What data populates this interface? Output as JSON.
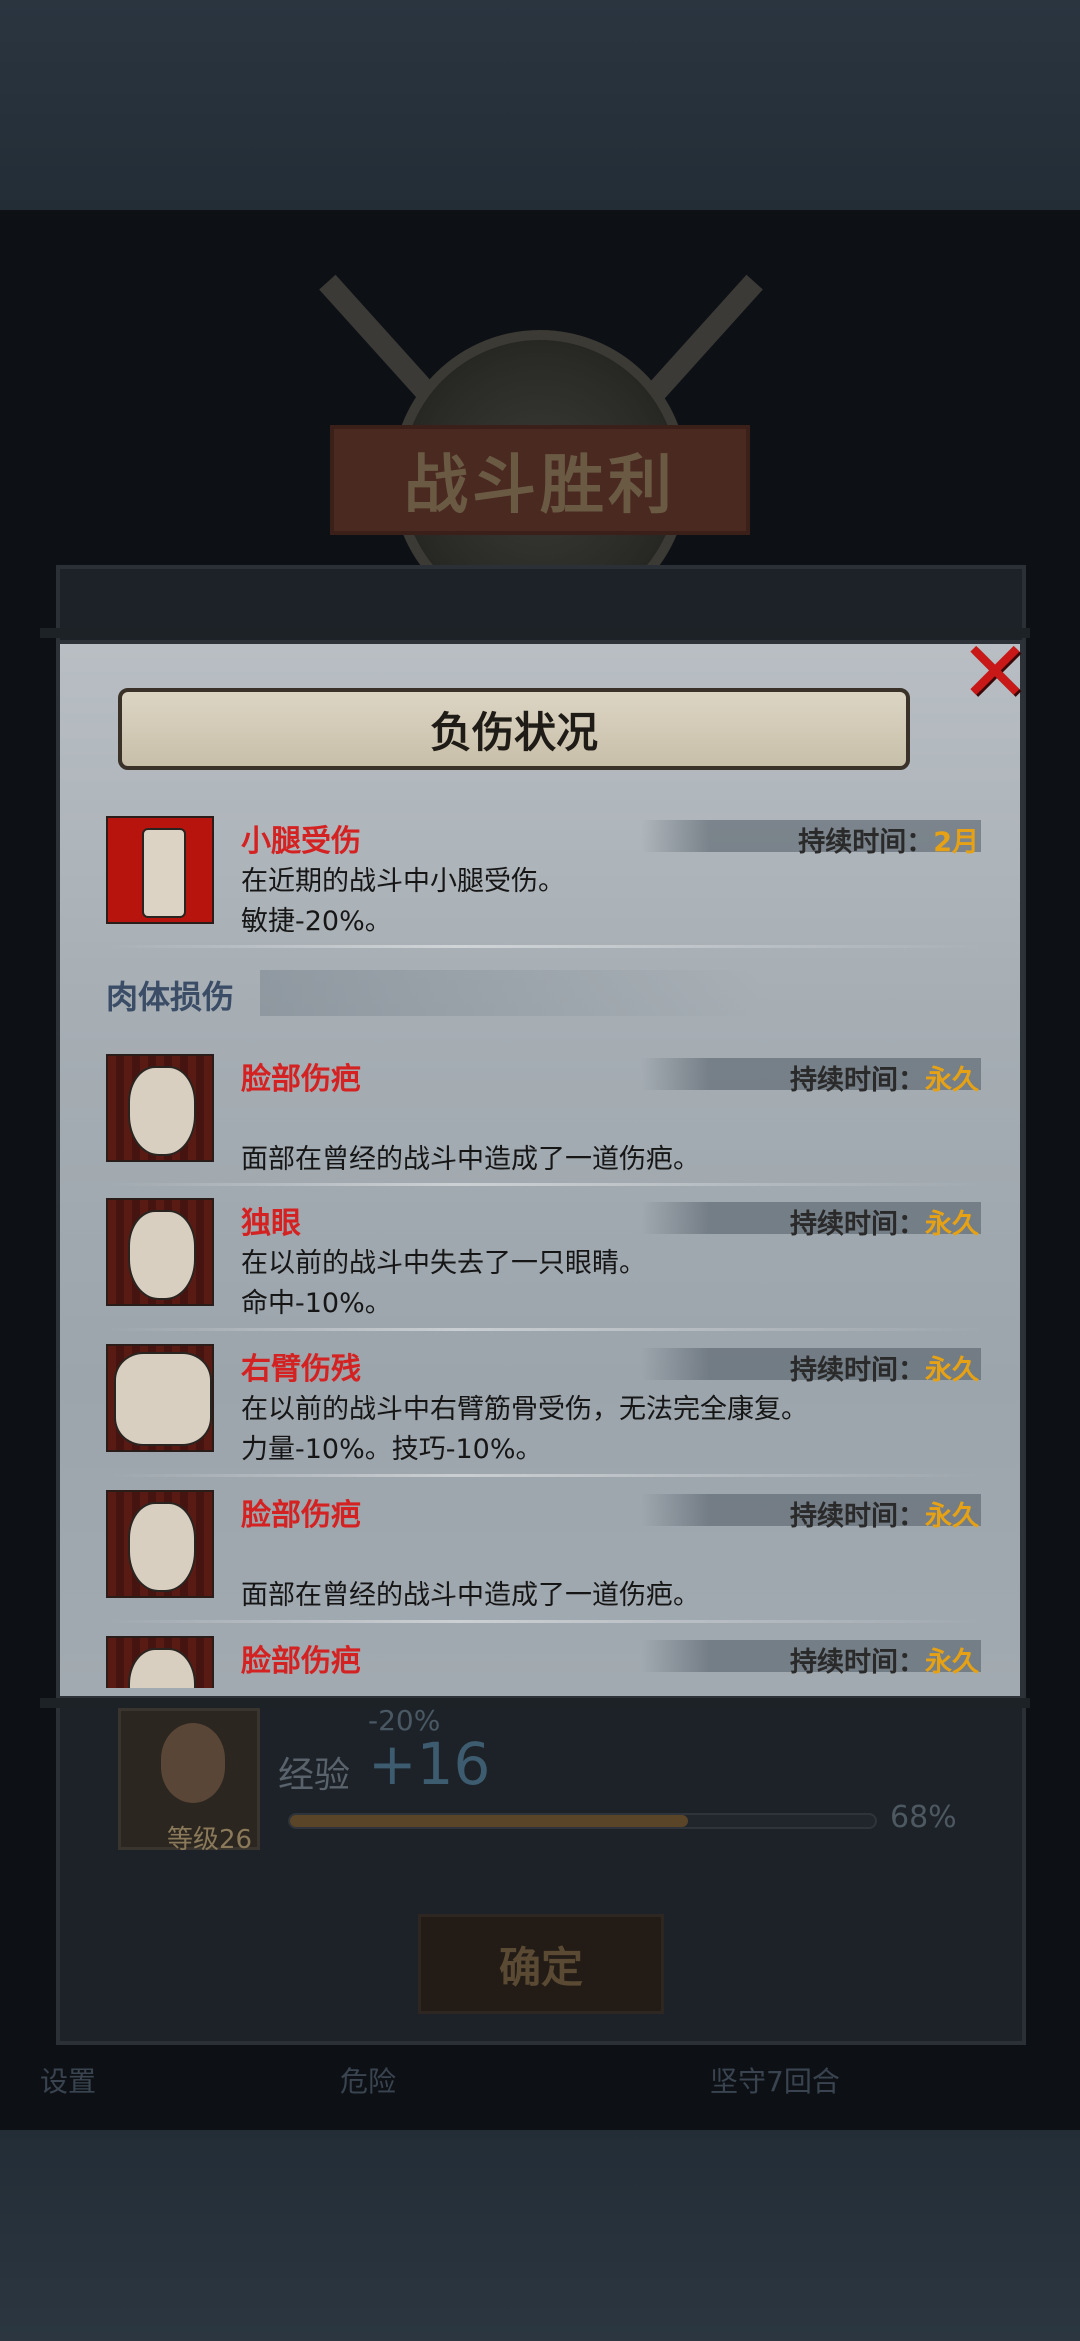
{
  "victory_title": "战斗胜利",
  "dialog": {
    "title": "负伤状况",
    "close_symbol": "✕",
    "section_label": "肉体损伤",
    "duration_label": "持续时间：",
    "injuries": [
      {
        "name": "小腿受伤",
        "duration": "2月",
        "icon": "bandaged-leg-icon",
        "lines": [
          "在近期的战斗中小腿受伤。",
          "敏捷-20%。"
        ]
      },
      {
        "name": "脸部伤疤",
        "duration": "永久",
        "icon": "bandaged-face-icon",
        "lines": [
          "",
          "面部在曾经的战斗中造成了一道伤疤。"
        ]
      },
      {
        "name": "独眼",
        "duration": "永久",
        "icon": "bandaged-face-icon",
        "lines": [
          "在以前的战斗中失去了一只眼睛。",
          "命中-10%。"
        ]
      },
      {
        "name": "右臂伤残",
        "duration": "永久",
        "icon": "bandaged-arm-icon",
        "lines": [
          "在以前的战斗中右臂筋骨受伤，无法完全康复。",
          "力量-10%。技巧-10%。"
        ]
      },
      {
        "name": "脸部伤疤",
        "duration": "永久",
        "icon": "bandaged-face-icon",
        "lines": [
          "",
          "面部在曾经的战斗中造成了一道伤疤。"
        ]
      },
      {
        "name": "脸部伤疤",
        "duration": "永久",
        "icon": "bandaged-face-icon",
        "lines": [
          "",
          ""
        ]
      }
    ]
  },
  "result": {
    "exp_label": "经验",
    "exp_penalty": "-20%",
    "exp_gain": "+16",
    "level_label": "等级26",
    "exp_percent": "68%",
    "exp_progress": 0.68,
    "confirm_label": "确定"
  },
  "nav": {
    "settings": "设置",
    "danger": "危险",
    "hold": "坚守7回合"
  },
  "colors": {
    "injury_name": "#d42222",
    "duration_value": "#e6a214",
    "close": "#c81818"
  }
}
